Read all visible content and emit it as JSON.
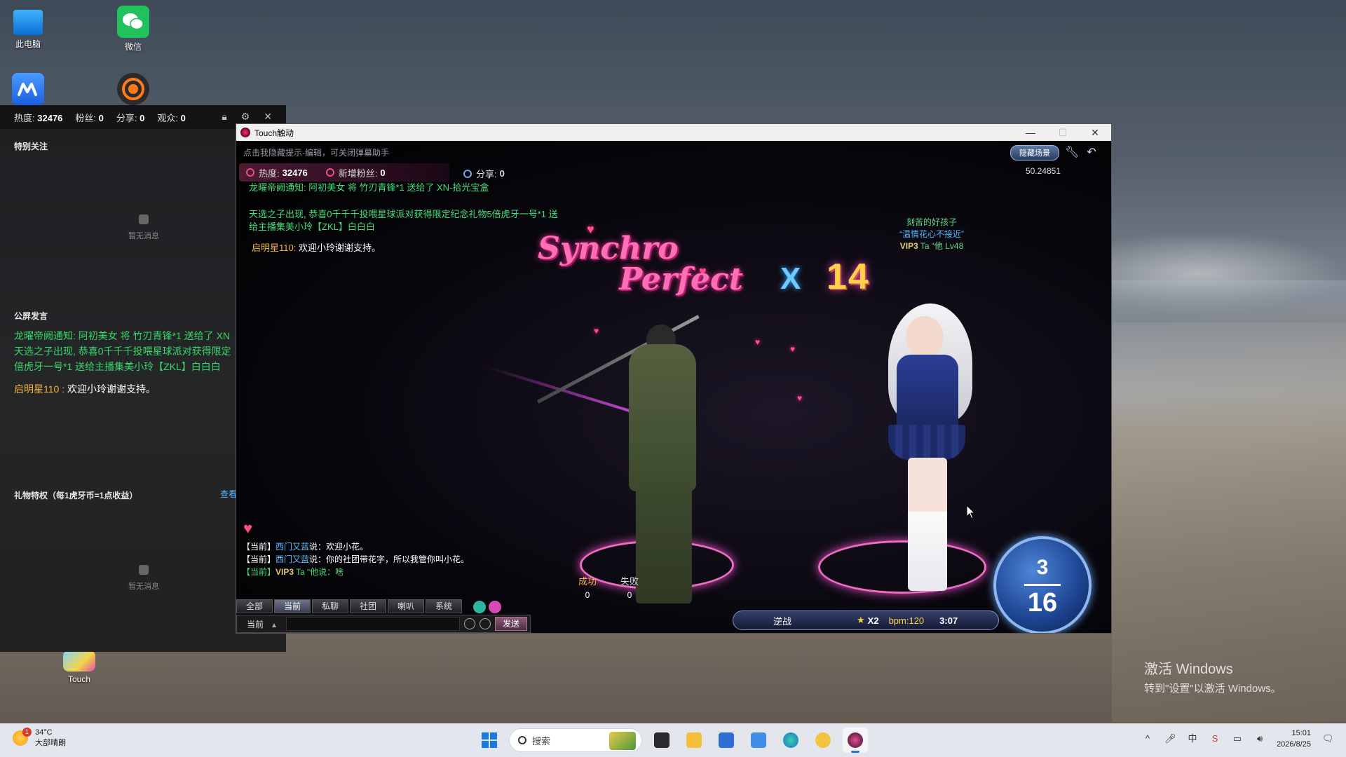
{
  "desktop": {
    "icons": [
      {
        "label": "此电脑"
      },
      {
        "label": "微信"
      },
      {
        "label": "Touch"
      }
    ]
  },
  "side_panel": {
    "stats": {
      "heat_label": "热度:",
      "heat_value": "32476",
      "fans_label": "粉丝:",
      "fans_value": "0",
      "share_label": "分享:",
      "share_value": "0",
      "viewers_label": "观众:",
      "viewers_value": "0"
    },
    "special_follow_title": "特别关注",
    "empty_text_1": "暂无消息",
    "public_chat_title": "公屏发言",
    "public_chat": {
      "line1": "龙曜帝阙通知: 阿初美女 将 竹刃青锋*1 送给了 XN",
      "line2": "天选之子出现, 恭喜0千千千投喂星球派对获得限定",
      "line3": "倍虎牙一号*1 送给主播集美小玲【ZKL】白白白",
      "line4_name": "启明星110 :",
      "line4_text": " 欢迎小玲谢谢支持。"
    },
    "gift_title": "礼物特权（每1虎牙币=1点收益）",
    "gift_link": "查看",
    "empty_text_2": "暂无消息"
  },
  "game_window": {
    "title": "Touch触动",
    "hint": "点击我隐藏提示-编辑，可关闭弹幕助手",
    "hide_scene_label": "隐藏场景",
    "coord": "50.24851",
    "stats": {
      "heat_label": "热度:",
      "heat_value": "32476",
      "fans_label": "新增粉丝:",
      "fans_value": "0",
      "share_label": "分享:",
      "share_value": "0"
    },
    "notices": {
      "n1": "龙曜帝阙通知: 阿初美女 将 竹刃青锋*1 送给了 XN-拾光宝盒",
      "n2a": "天选之子出现, 恭喜0千千千投喂星球派对获得限定纪念礼物5倍虎牙一号*1 送",
      "n2b": "给主播集美小玲【ZKL】白白白",
      "n3_name": "启明星110:",
      "n3_text": " 欢迎小玲谢谢支持。"
    },
    "player_tag": {
      "line1": "刻苦的好孩子",
      "line2": "“温情花心不接近”",
      "vip": "VIP3",
      "line3": " Ta “他 Lv48"
    },
    "combo": {
      "word1": "Synchro",
      "word2": "Perfect",
      "x": "X",
      "count": "14"
    },
    "score": {
      "success_label": "成功",
      "success_value": "0",
      "fail_label": "失败",
      "fail_value": "0"
    },
    "song": {
      "name": "逆战",
      "multiplier": "X2",
      "bpm": "bpm:120",
      "time": "3:07"
    },
    "dial": {
      "top": "3",
      "bottom": "16"
    },
    "chat": {
      "l1_prefix": "【当前】",
      "l1_name": "西门又蓝",
      "l1_text": "说：欢迎小花。",
      "l2_prefix": "【当前】",
      "l2_name": "西门又蓝",
      "l2_text": "说：你的社团带花字，所以我管你叫小花。",
      "l3_prefix": "【当前】",
      "l3_vip": "VIP3",
      "l3_text": " Ta “他说：啥"
    },
    "chat_tabs": [
      "全部",
      "当前",
      "私聊",
      "社团",
      "喇叭",
      "系统"
    ],
    "chat_input": {
      "channel": "当前",
      "placeholder": "",
      "send_label": "发送"
    }
  },
  "watermark": {
    "line1": "激活 Windows",
    "line2": "转到\"设置\"以激活 Windows。"
  },
  "taskbar": {
    "weather_temp": "34°C",
    "weather_desc": "大部晴朗",
    "weather_badge": "1",
    "search_placeholder": "搜索",
    "time": "15:01",
    "date": "2026/8/25",
    "tray_ime": "中"
  }
}
